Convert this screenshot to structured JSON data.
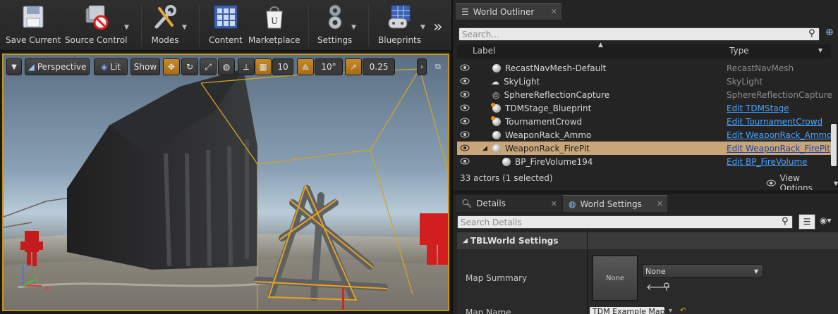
{
  "toolbar": {
    "buttons": [
      {
        "label": "Save Current",
        "icon": "save-icon"
      },
      {
        "label": "Source Control",
        "icon": "source-control-icon"
      },
      {
        "label": "Modes",
        "icon": "modes-icon"
      },
      {
        "label": "Content",
        "icon": "content-icon"
      },
      {
        "label": "Marketplace",
        "icon": "marketplace-icon"
      },
      {
        "label": "Settings",
        "icon": "settings-icon"
      },
      {
        "label": "Blueprints",
        "icon": "blueprints-icon"
      }
    ],
    "more_glyph": "»"
  },
  "viewport": {
    "perspective_label": "Perspective",
    "lit_label": "Lit",
    "show_label": "Show",
    "grid_snap_value": "10",
    "rotation_snap_value": "10°",
    "scale_snap_value": "0.25",
    "axis_labels": {
      "x": "X",
      "y": "Y",
      "z": "Z"
    }
  },
  "world_outliner": {
    "tab_title": "World Outliner",
    "search_placeholder": "Search...",
    "columns": {
      "label": "Label",
      "type": "Type"
    },
    "rows": [
      {
        "label": "RecastNavMesh-Default",
        "type": "RecastNavMesh",
        "type_style": "plain",
        "icon": "sphere-icon",
        "indent": 1,
        "selected": false
      },
      {
        "label": "SkyLight",
        "type": "SkyLight",
        "type_style": "plain",
        "icon": "skylight-icon",
        "indent": 1,
        "selected": false
      },
      {
        "label": "SphereReflectionCapture",
        "type": "SphereReflectionCapture",
        "type_style": "plain",
        "icon": "reflection-capture-icon",
        "indent": 1,
        "selected": false
      },
      {
        "label": "TDMStage_Blueprint",
        "type": "Edit TDMStage",
        "type_style": "link",
        "icon": "blueprint-actor-icon",
        "indent": 1,
        "selected": false
      },
      {
        "label": "TournamentCrowd",
        "type": "Edit TournamentCrowd",
        "type_style": "link",
        "icon": "blueprint-actor-icon",
        "indent": 1,
        "selected": false
      },
      {
        "label": "WeaponRack_Ammo",
        "type": "Edit WeaponRack_Ammo",
        "type_style": "link",
        "icon": "sphere-icon",
        "indent": 1,
        "selected": false
      },
      {
        "label": "WeaponRack_FirePit",
        "type": "Edit WeaponRack_FirePit",
        "type_style": "link",
        "icon": "sphere-icon",
        "indent": 1,
        "selected": true,
        "expanded": true
      },
      {
        "label": "BP_FireVolume194",
        "type": "Edit BP_FireVolume",
        "type_style": "link",
        "icon": "sphere-icon",
        "indent": 2,
        "selected": false
      }
    ],
    "status": "33 actors (1 selected)",
    "view_options_label": "View Options"
  },
  "details_tabs": [
    {
      "label": "Details",
      "icon": "details-icon",
      "active": false
    },
    {
      "label": "World Settings",
      "icon": "world-icon",
      "active": true
    }
  ],
  "details": {
    "search_placeholder": "Search Details",
    "section_title": "TBLWorld Settings",
    "properties": [
      {
        "name": "Map Summary",
        "thumbnail_text": "None",
        "dropdown_value": "None"
      },
      {
        "name": "Map Name",
        "value": "TDM Example Map"
      }
    ]
  }
}
